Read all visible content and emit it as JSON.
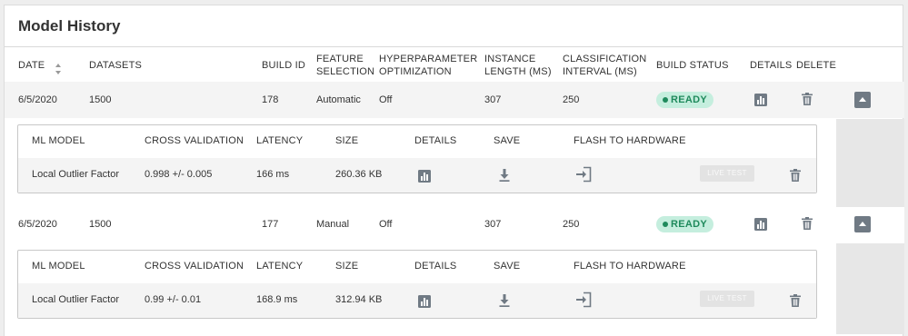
{
  "panel": {
    "title": "Model History"
  },
  "table": {
    "headers": {
      "date": "DATE",
      "datasets": "DATASETS",
      "build_id": "BUILD ID",
      "feature_selection_1": "FEATURE",
      "feature_selection_2": "SELECTION",
      "hyper_1": "HYPERPARAMETER",
      "hyper_2": "OPTIMIZATION",
      "instance_1": "INSTANCE",
      "instance_2": "LENGTH (MS)",
      "class_1": "CLASSIFICATION",
      "class_2": "INTERVAL (MS)",
      "build_status": "BUILD STATUS",
      "details": "DETAILS",
      "delete": "DELETE"
    },
    "rows": [
      {
        "date": "6/5/2020",
        "datasets": "1500",
        "build_id": "178",
        "feature_selection": "Automatic",
        "hyperparameter": "Off",
        "instance_length": "307",
        "classification_interval": "250",
        "status": "READY",
        "models": {
          "headers": {
            "ml_model": "ML MODEL",
            "cross_validation": "CROSS VALIDATION",
            "latency": "LATENCY",
            "size": "SIZE",
            "details": "DETAILS",
            "save": "SAVE",
            "flash": "FLASH TO HARDWARE"
          },
          "items": [
            {
              "name": "Local Outlier Factor",
              "cross_validation": "0.998 +/- 0.005",
              "latency": "166 ms",
              "size": "260.36 KB",
              "live_test": "LIVE TEST"
            }
          ]
        }
      },
      {
        "date": "6/5/2020",
        "datasets": "1500",
        "build_id": "177",
        "feature_selection": "Manual",
        "hyperparameter": "Off",
        "instance_length": "307",
        "classification_interval": "250",
        "status": "READY",
        "models": {
          "headers": {
            "ml_model": "ML MODEL",
            "cross_validation": "CROSS VALIDATION",
            "latency": "LATENCY",
            "size": "SIZE",
            "details": "DETAILS",
            "save": "SAVE",
            "flash": "FLASH TO HARDWARE"
          },
          "items": [
            {
              "name": "Local Outlier Factor",
              "cross_validation": "0.99 +/- 0.01",
              "latency": "168.9 ms",
              "size": "312.94 KB",
              "live_test": "LIVE TEST"
            }
          ]
        }
      }
    ]
  },
  "icons": {
    "details": "bar-chart-icon",
    "delete": "trash-icon",
    "save": "download-icon",
    "flash": "flash-to-hardware-icon",
    "expand": "collapse-arrow-icon"
  },
  "colors": {
    "ready_bg": "#c5eede",
    "ready_text": "#1f8a5c",
    "icon_gray": "#707a84",
    "row_bg": "#f4f4f4"
  }
}
